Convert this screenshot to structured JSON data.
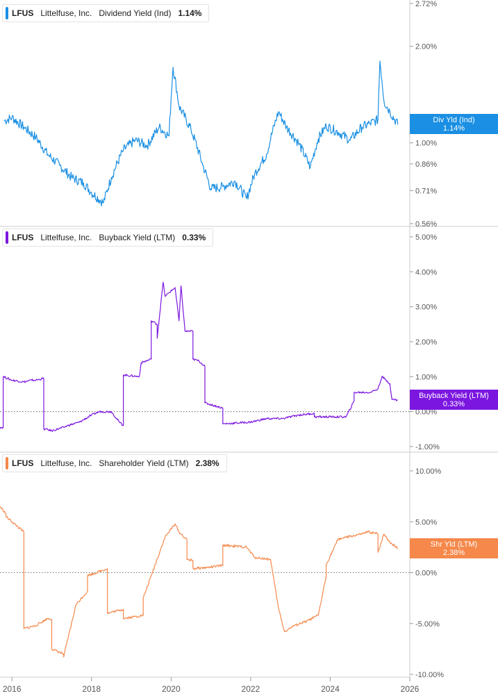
{
  "colors": {
    "dividend": "#1a8fe3",
    "buyback": "#7b16e0",
    "shareholder": "#f5884a",
    "axis_text": "#555555",
    "grid": "#dddddd"
  },
  "panels": [
    {
      "ticker": "LFUS",
      "company": "Littelfuse, Inc.",
      "metric": "Dividend Yield (Ind)",
      "value": "1.14%",
      "badge_title": "Div Yld (Ind)",
      "badge_value": "1.14%"
    },
    {
      "ticker": "LFUS",
      "company": "Littelfuse, Inc.",
      "metric": "Buyback Yield (LTM)",
      "value": "0.33%",
      "badge_title": "Buyback Yield (LTM)",
      "badge_value": "0.33%"
    },
    {
      "ticker": "LFUS",
      "company": "Littelfuse, Inc.",
      "metric": "Shareholder Yield (LTM)",
      "value": "2.38%",
      "badge_title": "Shr Yld (LTM)",
      "badge_value": "2.38%"
    }
  ],
  "chart_data": [
    {
      "type": "line",
      "scale": "log",
      "series_name": "Dividend Yield (Ind)",
      "ylim": [
        0.56,
        2.72
      ],
      "y_ticks": [
        "2.72%",
        "2.00%",
        "1.00%",
        "0.86%",
        "0.71%",
        "0.56%"
      ],
      "y_tick_values": [
        2.72,
        2.0,
        1.0,
        0.86,
        0.71,
        0.56
      ],
      "x": [
        2015.8,
        2016.0,
        2016.3,
        2016.6,
        2016.9,
        2017.2,
        2017.5,
        2017.8,
        2018.0,
        2018.3,
        2018.5,
        2018.8,
        2019.1,
        2019.4,
        2019.7,
        2019.95,
        2020.05,
        2020.2,
        2020.5,
        2020.8,
        2021.0,
        2021.3,
        2021.6,
        2021.9,
        2022.1,
        2022.4,
        2022.7,
        2022.9,
        2023.2,
        2023.5,
        2023.7,
        2023.9,
        2024.2,
        2024.5,
        2024.8,
        2025.0,
        2025.2,
        2025.25,
        2025.35,
        2025.5,
        2025.7
      ],
      "values": [
        1.17,
        1.2,
        1.12,
        1.04,
        0.92,
        0.85,
        0.78,
        0.75,
        0.7,
        0.65,
        0.78,
        0.95,
        1.02,
        0.98,
        1.12,
        1.05,
        1.72,
        1.3,
        1.1,
        0.85,
        0.72,
        0.73,
        0.76,
        0.67,
        0.8,
        0.92,
        1.25,
        1.12,
        1.0,
        0.84,
        1.03,
        1.13,
        1.08,
        1.02,
        1.12,
        1.15,
        1.18,
        1.8,
        1.35,
        1.25,
        1.14
      ]
    },
    {
      "type": "line",
      "series_name": "Buyback Yield (LTM)",
      "ylim": [
        -1.0,
        5.0
      ],
      "y_ticks": [
        "5.00%",
        "4.00%",
        "3.00%",
        "2.00%",
        "1.00%",
        "0.00%",
        "-1.00%"
      ],
      "y_tick_values": [
        5,
        4,
        3,
        2,
        1,
        0,
        -1
      ],
      "zero_line": true,
      "x": [
        2015.7,
        2015.78,
        2015.78,
        2016.0,
        2016.3,
        2016.5,
        2016.6,
        2016.8,
        2016.8,
        2016.85,
        2017.0,
        2017.3,
        2017.4,
        2017.7,
        2018.0,
        2018.2,
        2018.5,
        2018.7,
        2018.8,
        2018.8,
        2019.2,
        2019.25,
        2019.25,
        2019.5,
        2019.5,
        2019.65,
        2019.65,
        2019.8,
        2019.85,
        2020.1,
        2020.2,
        2020.25,
        2020.35,
        2020.55,
        2020.55,
        2020.7,
        2020.85,
        2020.85,
        2021.15,
        2021.3,
        2021.3,
        2022.0,
        2022.4,
        2022.8,
        2023.2,
        2023.6,
        2023.6,
        2024.0,
        2024.4,
        2024.6,
        2024.6,
        2025.0,
        2025.2,
        2025.3,
        2025.5,
        2025.55,
        2025.7
      ],
      "values": [
        -0.45,
        -0.45,
        1.0,
        0.9,
        0.85,
        0.9,
        0.9,
        0.95,
        -0.5,
        -0.5,
        -0.55,
        -0.45,
        -0.4,
        -0.3,
        -0.1,
        0.0,
        0.0,
        -0.3,
        -0.4,
        1.05,
        1.0,
        1.4,
        1.4,
        1.5,
        2.6,
        2.5,
        2.1,
        3.7,
        3.3,
        3.55,
        2.6,
        3.6,
        2.3,
        2.3,
        1.5,
        1.45,
        1.3,
        0.25,
        0.15,
        0.1,
        -0.35,
        -0.3,
        -0.2,
        -0.2,
        -0.1,
        -0.05,
        -0.15,
        -0.15,
        -0.15,
        0.3,
        0.55,
        0.55,
        0.65,
        1.0,
        0.8,
        0.35,
        0.33
      ]
    },
    {
      "type": "line",
      "series_name": "Shareholder Yield (LTM)",
      "ylim": [
        -10.0,
        10.0
      ],
      "y_ticks": [
        "10.00%",
        "5.00%",
        "0.00%",
        "-5.00%",
        "-10.00%"
      ],
      "y_tick_values": [
        10,
        5,
        0,
        -5,
        -10
      ],
      "zero_line": true,
      "x": [
        2015.7,
        2015.85,
        2015.85,
        2016.3,
        2016.3,
        2016.6,
        2016.9,
        2017.0,
        2017.0,
        2017.3,
        2017.3,
        2017.6,
        2017.6,
        2017.9,
        2017.9,
        2018.4,
        2018.4,
        2018.8,
        2018.8,
        2019.3,
        2019.3,
        2019.85,
        2020.1,
        2020.2,
        2020.4,
        2020.4,
        2020.55,
        2020.55,
        2020.9,
        2021.3,
        2021.3,
        2021.9,
        2022.1,
        2022.5,
        2022.7,
        2022.85,
        2023.1,
        2023.4,
        2023.7,
        2023.9,
        2023.9,
        2024.2,
        2024.8,
        2024.95,
        2025.2,
        2025.2,
        2025.35,
        2025.5,
        2025.7
      ],
      "values": [
        6.5,
        5.8,
        5.5,
        4.0,
        -5.5,
        -5.2,
        -4.5,
        -4.6,
        -7.5,
        -8.0,
        -8.3,
        -3.3,
        -3.2,
        -1.8,
        -0.3,
        0.4,
        -4.0,
        -3.6,
        -4.5,
        -4.2,
        -2.5,
        3.5,
        4.8,
        4.0,
        3.2,
        1.3,
        1.2,
        0.4,
        0.5,
        0.7,
        2.7,
        2.5,
        1.5,
        1.3,
        -3.5,
        -5.8,
        -5.2,
        -4.8,
        -4.2,
        -0.3,
        0.8,
        3.3,
        3.8,
        4.0,
        3.8,
        2.0,
        3.8,
        3.0,
        2.38
      ]
    }
  ],
  "x_axis": {
    "ticks": [
      "2016",
      "2018",
      "2020",
      "2022",
      "2024",
      "2026"
    ],
    "tick_values": [
      2016,
      2018,
      2020,
      2022,
      2024,
      2026
    ],
    "xlim": [
      2015.7,
      2026.0
    ]
  }
}
